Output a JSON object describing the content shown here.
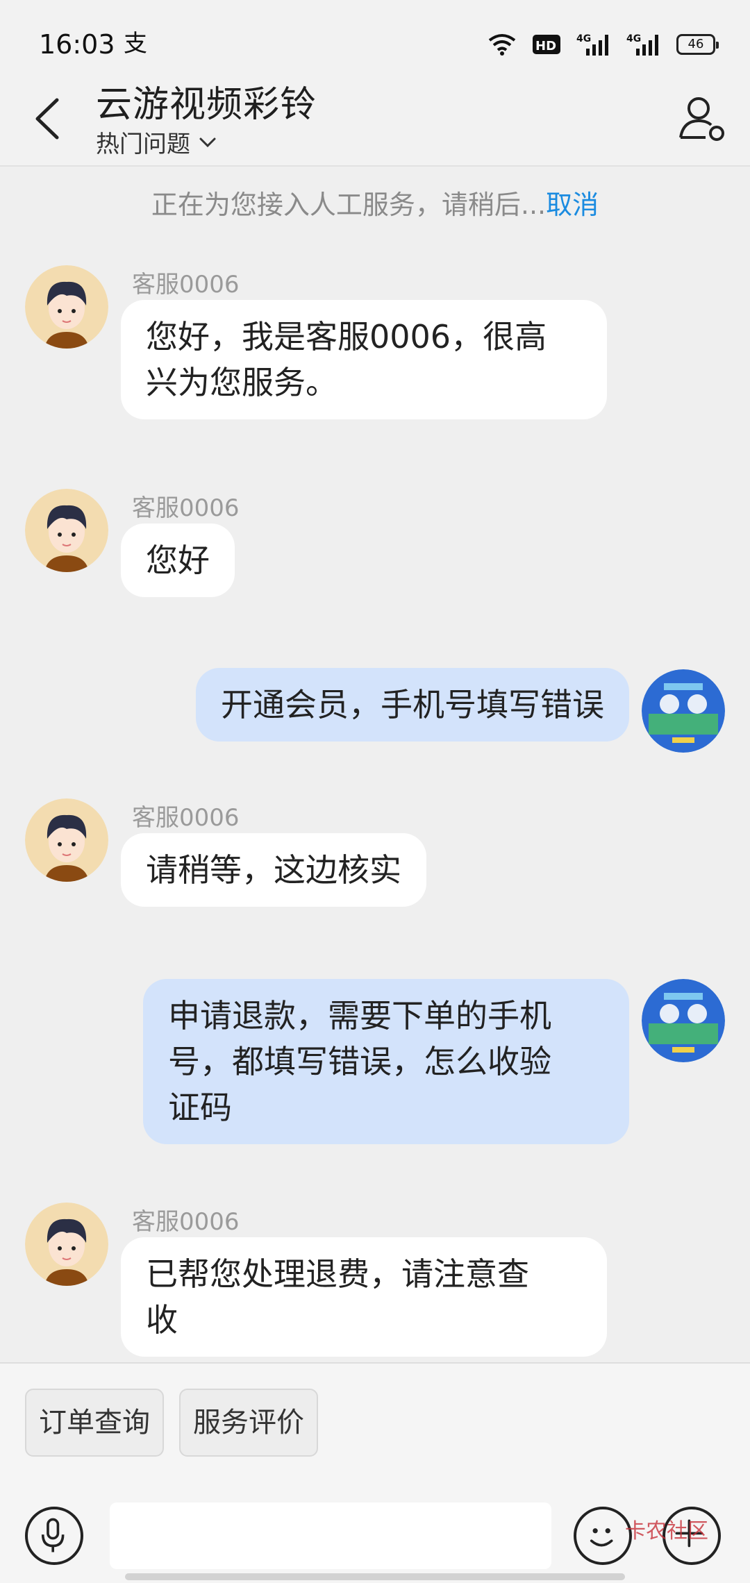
{
  "status_bar": {
    "time": "16:03",
    "app_icon": "支",
    "battery": "46",
    "network_a": "4G",
    "network_b": "4G",
    "hd": "HD"
  },
  "header": {
    "title": "云游视频彩铃",
    "subtitle": "热门问题",
    "back_icon": "chevron-left-icon",
    "user_icon": "user-settings-icon"
  },
  "notice": {
    "text": "正在为您接入人工服务，请稍后...",
    "cancel": "取消"
  },
  "messages": [
    {
      "direction": "in",
      "sender": "客服0006",
      "text": "您好，我是客服0006，很高兴为您服务。",
      "lines": [
        "您好，我是客服0006，很高",
        "兴为您服务。"
      ]
    },
    {
      "direction": "in",
      "sender": "客服0006",
      "text": "您好",
      "lines": [
        "您好"
      ]
    },
    {
      "direction": "out",
      "text": "开通会员，手机号填写错误",
      "lines": [
        "开通会员，手机号填写错误"
      ]
    },
    {
      "direction": "in",
      "sender": "客服0006",
      "text": "请稍等，这边核实",
      "lines": [
        "请稍等，这边核实"
      ]
    },
    {
      "direction": "out",
      "text": "申请退款，需要下单的手机号，都填写错误，怎么收验证码",
      "lines": [
        "申请退款，需要下单的手机",
        "号，都填写错误，怎么收验",
        "证码"
      ]
    },
    {
      "direction": "in",
      "sender": "客服0006",
      "text": "已帮您处理退费，请注意查收",
      "lines": [
        "已帮您处理退费，请注意查",
        "收"
      ]
    }
  ],
  "quick_actions": [
    {
      "label": "订单查询"
    },
    {
      "label": "服务评价"
    }
  ],
  "input": {
    "placeholder": "",
    "value": ""
  },
  "watermark": "卡农社区"
}
